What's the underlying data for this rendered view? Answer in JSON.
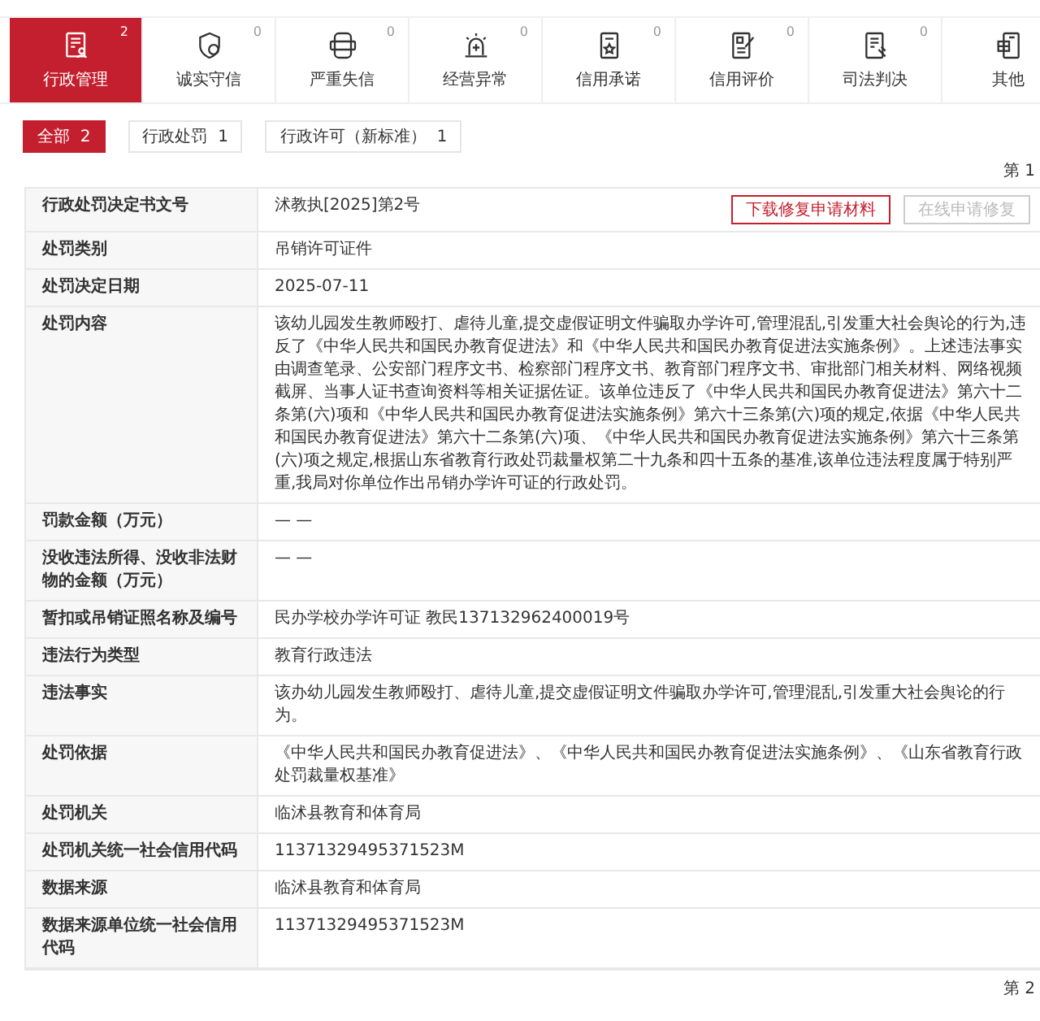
{
  "category_tabs": [
    {
      "label": "行政管理",
      "count": "2",
      "selected": true
    },
    {
      "label": "诚实守信",
      "count": "0",
      "selected": false
    },
    {
      "label": "严重失信",
      "count": "0",
      "selected": false
    },
    {
      "label": "经营异常",
      "count": "0",
      "selected": false
    },
    {
      "label": "信用承诺",
      "count": "0",
      "selected": false
    },
    {
      "label": "信用评价",
      "count": "0",
      "selected": false
    },
    {
      "label": "司法判决",
      "count": "0",
      "selected": false
    },
    {
      "label": "其他",
      "selected": false
    }
  ],
  "filter_chips": [
    {
      "label": "全部",
      "count": "2",
      "selected": true
    },
    {
      "label": "行政处罚",
      "count": "1",
      "selected": false
    },
    {
      "label": "行政许可（新标准）",
      "count": "1",
      "selected": false
    }
  ],
  "page_indicator_top": "第 1",
  "record": {
    "buttons": [
      {
        "label": "下载修复申请材料",
        "disabled": false
      },
      {
        "label": "在线申请修复",
        "disabled": true
      }
    ],
    "rows": [
      {
        "label": "行政处罚决定书文号",
        "value": "沭教执[2025]第2号"
      },
      {
        "label": "处罚类别",
        "value": "吊销许可证件"
      },
      {
        "label": "处罚决定日期",
        "value": "2025-07-11"
      },
      {
        "label": "处罚内容",
        "value": "该幼儿园发生教师殴打、虐待儿童,提交虚假证明文件骗取办学许可,管理混乱,引发重大社会舆论的行为,违反了《中华人民共和国民办教育促进法》和《中华人民共和国民办教育促进法实施条例》。上述违法事实由调查笔录、公安部门程序文书、检察部门程序文书、教育部门程序文书、审批部门相关材料、网络视频截屏、当事人证书查询资料等相关证据佐证。该单位违反了《中华人民共和国民办教育促进法》第六十二条第(六)项和《中华人民共和国民办教育促进法实施条例》第六十三条第(六)项的规定,依据《中华人民共和国民办教育促进法》第六十二条第(六)项、《中华人民共和国民办教育促进法实施条例》第六十三条第(六)项之规定,根据山东省教育行政处罚裁量权第二十九条和四十五条的基准,该单位违法程度属于特别严重,我局对你单位作出吊销办学许可证的行政处罚。"
      },
      {
        "label": "罚款金额（万元）",
        "value": "— —"
      },
      {
        "label": "没收违法所得、没收非法财物的金额（万元）",
        "value": "— —"
      },
      {
        "label": "暂扣或吊销证照名称及编号",
        "value": "民办学校办学许可证 教民137132962400019号"
      },
      {
        "label": "违法行为类型",
        "value": "教育行政违法"
      },
      {
        "label": "违法事实",
        "value": "该办幼儿园发生教师殴打、虐待儿童,提交虚假证明文件骗取办学许可,管理混乱,引发重大社会舆论的行为。"
      },
      {
        "label": "处罚依据",
        "value": "《中华人民共和国民办教育促进法》、《中华人民共和国民办教育促进法实施条例》、《山东省教育行政处罚裁量权基准》"
      },
      {
        "label": "处罚机关",
        "value": "临沭县教育和体育局"
      },
      {
        "label": "处罚机关统一社会信用代码",
        "value": "11371329495371523M"
      },
      {
        "label": "数据来源",
        "value": "临沭县教育和体育局"
      },
      {
        "label": "数据来源单位统一社会信用代码",
        "value": "11371329495371523M"
      }
    ]
  },
  "page_indicator_bottom": "第 2"
}
